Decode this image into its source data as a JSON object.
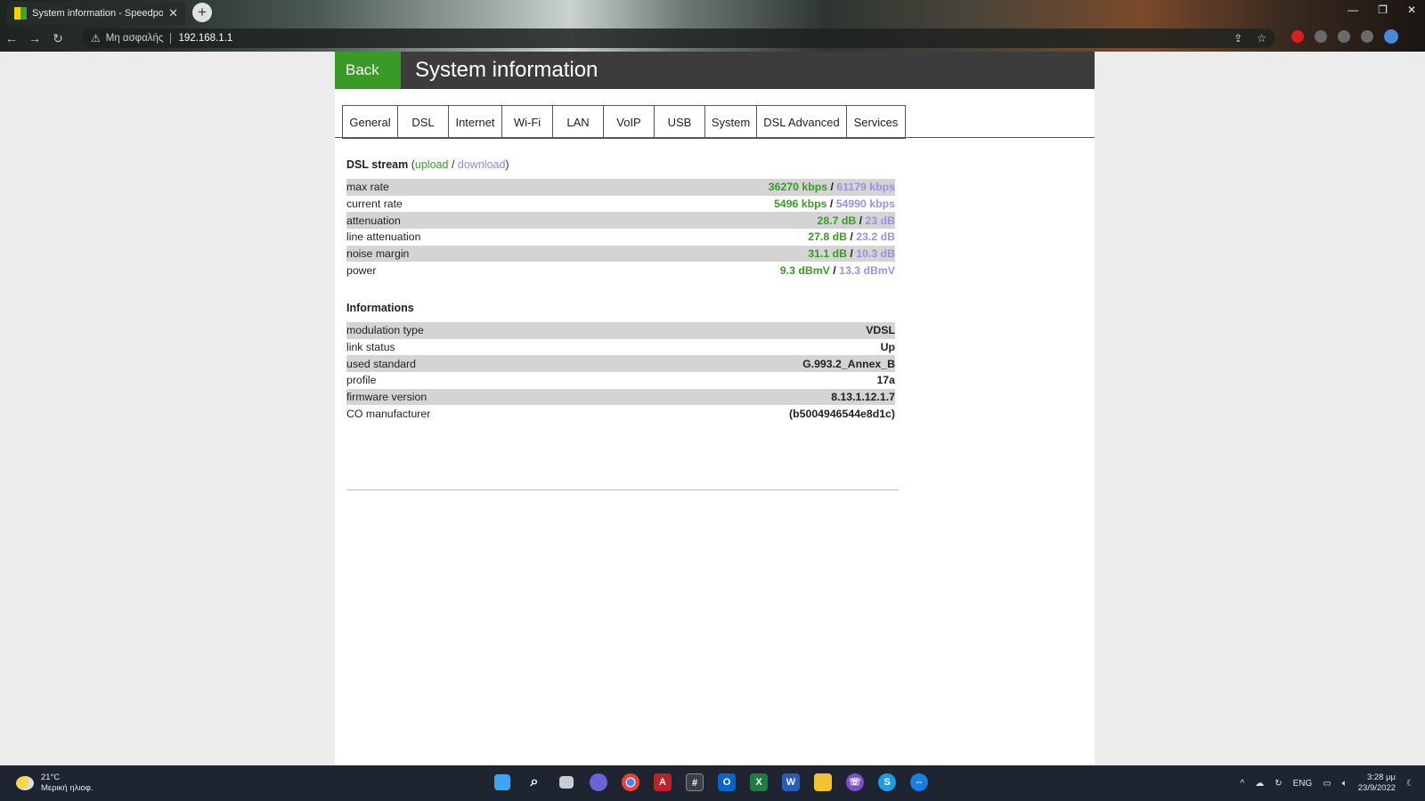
{
  "browser": {
    "tab_title": "System information - Speedport",
    "tab_close": "✕",
    "new_tab": "+",
    "security_label": "Μη ασφαλής",
    "url": "192.168.1.1"
  },
  "header": {
    "back_label": "Back",
    "title": "System information"
  },
  "tabs": [
    "General",
    "DSL",
    "Internet",
    "Wi-Fi",
    "LAN",
    "VoIP",
    "USB",
    "System",
    "DSL Advanced",
    "Services"
  ],
  "dsl_stream": {
    "title": "DSL stream",
    "upload_link": "upload",
    "separator": "/",
    "download_link": "download",
    "rows": [
      {
        "label": "max rate",
        "upload": "36270 kbps",
        "download": "61179 kbps"
      },
      {
        "label": "current rate",
        "upload": "5496 kbps",
        "download": "54990 kbps"
      },
      {
        "label": "attenuation",
        "upload": "28.7 dB",
        "download": "23 dB"
      },
      {
        "label": "line attenuation",
        "upload": "27.8 dB",
        "download": "23.2 dB"
      },
      {
        "label": "noise margin",
        "upload": "31.1 dB",
        "download": "10.3 dB"
      },
      {
        "label": "power",
        "upload": "9.3 dBmV",
        "download": "13.3 dBmV"
      }
    ]
  },
  "informations": {
    "title": "Informations",
    "rows": [
      {
        "label": "modulation type",
        "value": "VDSL"
      },
      {
        "label": "link status",
        "value": "Up"
      },
      {
        "label": "used standard",
        "value": "G.993.2_Annex_B"
      },
      {
        "label": "profile",
        "value": "17a"
      },
      {
        "label": "firmware version",
        "value": "8.13.1.12.1.7"
      },
      {
        "label": "CO manufacturer",
        "value": "(b5004946544e8d1c)"
      }
    ]
  },
  "taskbar": {
    "temperature": "21°C",
    "weather": "Μερική ηλιοφ.",
    "language": "ENG",
    "time": "3:28 μμ",
    "date": "23/9/2022"
  },
  "colors": {
    "accent_green": "#3a9a28",
    "download_purple": "#9494e2",
    "header_bg": "#3c3c3c"
  }
}
